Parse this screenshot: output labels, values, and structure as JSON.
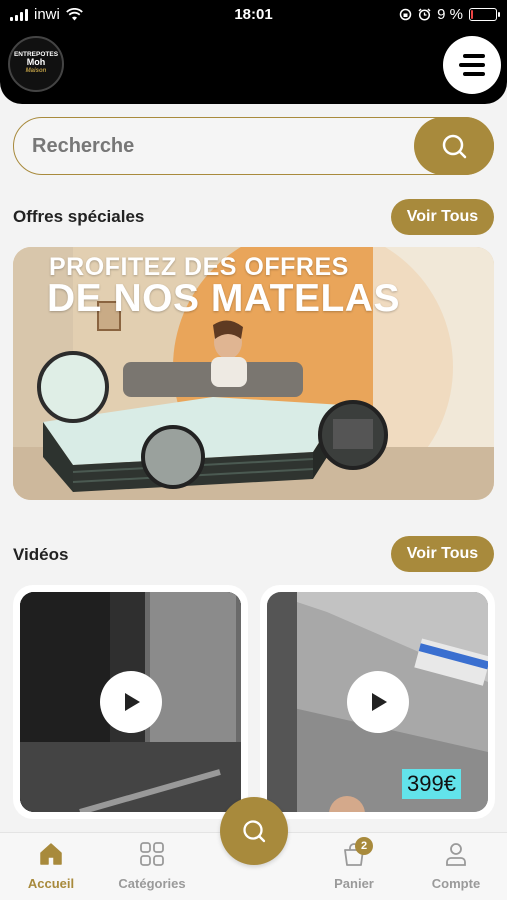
{
  "status_bar": {
    "carrier": "inwi",
    "time": "18:01",
    "battery": "9 %",
    "battery_level": 0.09
  },
  "header": {
    "logo": {
      "line1": "ENTREPOTES",
      "line2": "Moh",
      "line3": "Maison"
    },
    "menu_icon": "hamburger-menu-icon"
  },
  "search": {
    "placeholder": "Recherche",
    "button_icon": "search-icon"
  },
  "special_offers": {
    "title": "Offres spéciales",
    "see_all": "Voir Tous",
    "banner": {
      "line1": "PROFITEZ DES OFFRES",
      "line2": "DE NOS MATELAS"
    }
  },
  "videos": {
    "title": "Vidéos",
    "see_all": "Voir Tous",
    "items": [
      {
        "play_icon": "play-icon"
      },
      {
        "play_icon": "play-icon",
        "price_tag": "399€"
      }
    ]
  },
  "bottom_nav": {
    "items": [
      {
        "label": "Accueil",
        "icon": "home-icon",
        "active": true
      },
      {
        "label": "Catégories",
        "icon": "grid-icon",
        "active": false
      },
      {
        "label": "Panier",
        "icon": "bag-icon",
        "badge": "2",
        "active": false
      },
      {
        "label": "Compte",
        "icon": "user-icon",
        "active": false
      }
    ],
    "center_icon": "search-icon"
  },
  "colors": {
    "accent": "#a88a3c",
    "header_bg": "#000000",
    "page_bg": "#f3f3f3"
  }
}
